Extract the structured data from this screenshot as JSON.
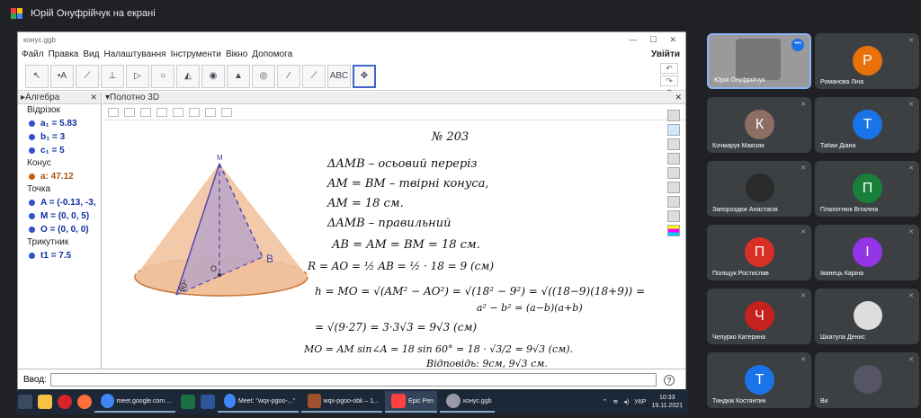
{
  "meet": {
    "presenting_title": "Юрій Онуфрійчук на екрані"
  },
  "ggb": {
    "window_title": "конус.ggb",
    "menu": [
      "Файл",
      "Правка",
      "Вид",
      "Налаштування",
      "Інструменти",
      "Вікно",
      "Допомога"
    ],
    "login": "Увійти",
    "tools": [
      "↖",
      "•A",
      "⟋",
      "⊥",
      "▷",
      "○",
      "◭",
      "◉",
      "▲",
      "◎",
      "∕",
      "⟋",
      "ABC",
      "✥"
    ],
    "algebra_title": "Алгебра",
    "view3d_title": "Полотно 3D",
    "algebra": [
      {
        "group": "Відрізок",
        "items": [
          {
            "text": "a₁ = 5.83",
            "style": "blue"
          },
          {
            "text": "b₁ = 3",
            "style": "blue"
          },
          {
            "text": "c₁ = 5",
            "style": "blue"
          }
        ]
      },
      {
        "group": "Конус",
        "items": [
          {
            "text": "a: 47.12",
            "style": "orange"
          }
        ]
      },
      {
        "group": "Точка",
        "items": [
          {
            "text": "A = (-0.13, -3,",
            "style": "blue"
          },
          {
            "text": "M = (0, 0, 5)",
            "style": "blue"
          },
          {
            "text": "O = (0, 0, 0)",
            "style": "blue"
          }
        ]
      },
      {
        "group": "Трикутник",
        "items": [
          {
            "text": "t1 = 7.5",
            "style": "blue"
          }
        ]
      }
    ],
    "input_label": "Ввод:",
    "labels": {
      "M": "M",
      "B": "B",
      "O": "O",
      "A": "A",
      "angle": "60°"
    },
    "handwriting": [
      "№ 203",
      "ΔAMB – осьовий переріз",
      "AM = BM – твірні конуса,",
      "AM = 18 см.",
      "ΔAMB – правильний",
      "AB = AM = BM = 18 см.",
      "R = AO = ½ AB = ½ · 18 = 9 (см)",
      "h = MO = √(AM² − AO²) = √(18² − 9²) = √((18−9)(18+9)) =",
      "a² − b² = (a−b)(a+b)",
      "= √(9·27) = 3·3√3 = 9√3 (см)",
      "MO = AM sin∠A = 18 sin 60° = 18 · √3/2 = 9√3 (см).",
      "Відповідь: 9см, 9√3 см."
    ]
  },
  "taskbar": {
    "tasks": [
      "meet.google.com ...",
      "Meet: \"wqx-pgoo-...\"",
      "wqx-pgoo-obk – 1...",
      "Epic Pen",
      "конус.ggb"
    ],
    "lang": "УКР",
    "time": "10:33",
    "date": "19.11.2021"
  },
  "participants": [
    {
      "name": "Юрій Онуфрійчук",
      "letter": "",
      "color": "#6d6d6d",
      "photo": true
    },
    {
      "name": "Романова Ліна",
      "letter": "Р",
      "color": "#e8710a"
    },
    {
      "name": "Кочмарук Максим",
      "letter": "К",
      "color": "#8d6e63"
    },
    {
      "name": "Табан Діана",
      "letter": "Т",
      "color": "#1a73e8"
    },
    {
      "name": "Запороздюк Анастасія",
      "letter": "",
      "color": "#444",
      "photo": true
    },
    {
      "name": "Плахотнюк Віталіна",
      "letter": "П",
      "color": "#188038"
    },
    {
      "name": "Поліщук Ростислав",
      "letter": "П",
      "color": "#d93025"
    },
    {
      "name": "Іванець Каріна",
      "letter": "І",
      "color": "#9334e6"
    },
    {
      "name": "Чепурко Катерина",
      "letter": "Ч",
      "color": "#c5221f"
    },
    {
      "name": "Шкатула Денис",
      "letter": "",
      "color": "#666",
      "photo": true
    },
    {
      "name": "Тиндюк Костянтин",
      "letter": "Т",
      "color": "#1a73e8"
    },
    {
      "name": "Ви",
      "letter": "",
      "color": "#555",
      "photo": true
    }
  ]
}
